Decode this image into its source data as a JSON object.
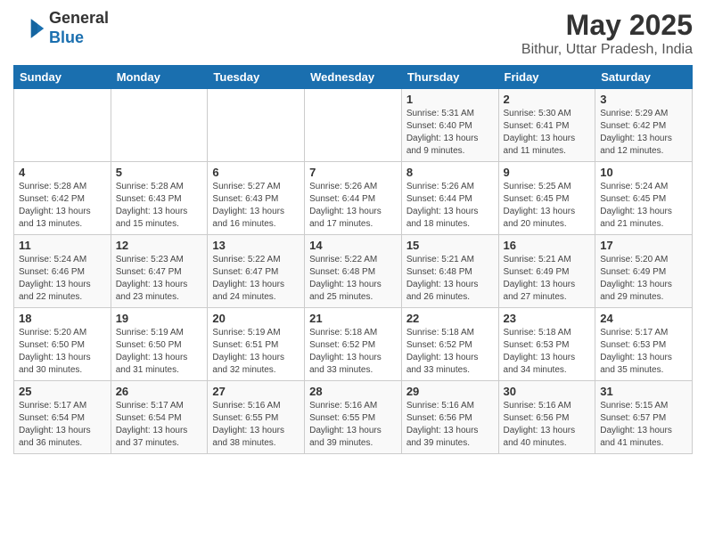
{
  "header": {
    "logo_general": "General",
    "logo_blue": "Blue",
    "month_year": "May 2025",
    "location": "Bithur, Uttar Pradesh, India"
  },
  "days_of_week": [
    "Sunday",
    "Monday",
    "Tuesday",
    "Wednesday",
    "Thursday",
    "Friday",
    "Saturday"
  ],
  "weeks": [
    [
      {
        "day": "",
        "info": ""
      },
      {
        "day": "",
        "info": ""
      },
      {
        "day": "",
        "info": ""
      },
      {
        "day": "",
        "info": ""
      },
      {
        "day": "1",
        "info": "Sunrise: 5:31 AM\nSunset: 6:40 PM\nDaylight: 13 hours\nand 9 minutes."
      },
      {
        "day": "2",
        "info": "Sunrise: 5:30 AM\nSunset: 6:41 PM\nDaylight: 13 hours\nand 11 minutes."
      },
      {
        "day": "3",
        "info": "Sunrise: 5:29 AM\nSunset: 6:42 PM\nDaylight: 13 hours\nand 12 minutes."
      }
    ],
    [
      {
        "day": "4",
        "info": "Sunrise: 5:28 AM\nSunset: 6:42 PM\nDaylight: 13 hours\nand 13 minutes."
      },
      {
        "day": "5",
        "info": "Sunrise: 5:28 AM\nSunset: 6:43 PM\nDaylight: 13 hours\nand 15 minutes."
      },
      {
        "day": "6",
        "info": "Sunrise: 5:27 AM\nSunset: 6:43 PM\nDaylight: 13 hours\nand 16 minutes."
      },
      {
        "day": "7",
        "info": "Sunrise: 5:26 AM\nSunset: 6:44 PM\nDaylight: 13 hours\nand 17 minutes."
      },
      {
        "day": "8",
        "info": "Sunrise: 5:26 AM\nSunset: 6:44 PM\nDaylight: 13 hours\nand 18 minutes."
      },
      {
        "day": "9",
        "info": "Sunrise: 5:25 AM\nSunset: 6:45 PM\nDaylight: 13 hours\nand 20 minutes."
      },
      {
        "day": "10",
        "info": "Sunrise: 5:24 AM\nSunset: 6:45 PM\nDaylight: 13 hours\nand 21 minutes."
      }
    ],
    [
      {
        "day": "11",
        "info": "Sunrise: 5:24 AM\nSunset: 6:46 PM\nDaylight: 13 hours\nand 22 minutes."
      },
      {
        "day": "12",
        "info": "Sunrise: 5:23 AM\nSunset: 6:47 PM\nDaylight: 13 hours\nand 23 minutes."
      },
      {
        "day": "13",
        "info": "Sunrise: 5:22 AM\nSunset: 6:47 PM\nDaylight: 13 hours\nand 24 minutes."
      },
      {
        "day": "14",
        "info": "Sunrise: 5:22 AM\nSunset: 6:48 PM\nDaylight: 13 hours\nand 25 minutes."
      },
      {
        "day": "15",
        "info": "Sunrise: 5:21 AM\nSunset: 6:48 PM\nDaylight: 13 hours\nand 26 minutes."
      },
      {
        "day": "16",
        "info": "Sunrise: 5:21 AM\nSunset: 6:49 PM\nDaylight: 13 hours\nand 27 minutes."
      },
      {
        "day": "17",
        "info": "Sunrise: 5:20 AM\nSunset: 6:49 PM\nDaylight: 13 hours\nand 29 minutes."
      }
    ],
    [
      {
        "day": "18",
        "info": "Sunrise: 5:20 AM\nSunset: 6:50 PM\nDaylight: 13 hours\nand 30 minutes."
      },
      {
        "day": "19",
        "info": "Sunrise: 5:19 AM\nSunset: 6:50 PM\nDaylight: 13 hours\nand 31 minutes."
      },
      {
        "day": "20",
        "info": "Sunrise: 5:19 AM\nSunset: 6:51 PM\nDaylight: 13 hours\nand 32 minutes."
      },
      {
        "day": "21",
        "info": "Sunrise: 5:18 AM\nSunset: 6:52 PM\nDaylight: 13 hours\nand 33 minutes."
      },
      {
        "day": "22",
        "info": "Sunrise: 5:18 AM\nSunset: 6:52 PM\nDaylight: 13 hours\nand 33 minutes."
      },
      {
        "day": "23",
        "info": "Sunrise: 5:18 AM\nSunset: 6:53 PM\nDaylight: 13 hours\nand 34 minutes."
      },
      {
        "day": "24",
        "info": "Sunrise: 5:17 AM\nSunset: 6:53 PM\nDaylight: 13 hours\nand 35 minutes."
      }
    ],
    [
      {
        "day": "25",
        "info": "Sunrise: 5:17 AM\nSunset: 6:54 PM\nDaylight: 13 hours\nand 36 minutes."
      },
      {
        "day": "26",
        "info": "Sunrise: 5:17 AM\nSunset: 6:54 PM\nDaylight: 13 hours\nand 37 minutes."
      },
      {
        "day": "27",
        "info": "Sunrise: 5:16 AM\nSunset: 6:55 PM\nDaylight: 13 hours\nand 38 minutes."
      },
      {
        "day": "28",
        "info": "Sunrise: 5:16 AM\nSunset: 6:55 PM\nDaylight: 13 hours\nand 39 minutes."
      },
      {
        "day": "29",
        "info": "Sunrise: 5:16 AM\nSunset: 6:56 PM\nDaylight: 13 hours\nand 39 minutes."
      },
      {
        "day": "30",
        "info": "Sunrise: 5:16 AM\nSunset: 6:56 PM\nDaylight: 13 hours\nand 40 minutes."
      },
      {
        "day": "31",
        "info": "Sunrise: 5:15 AM\nSunset: 6:57 PM\nDaylight: 13 hours\nand 41 minutes."
      }
    ]
  ]
}
